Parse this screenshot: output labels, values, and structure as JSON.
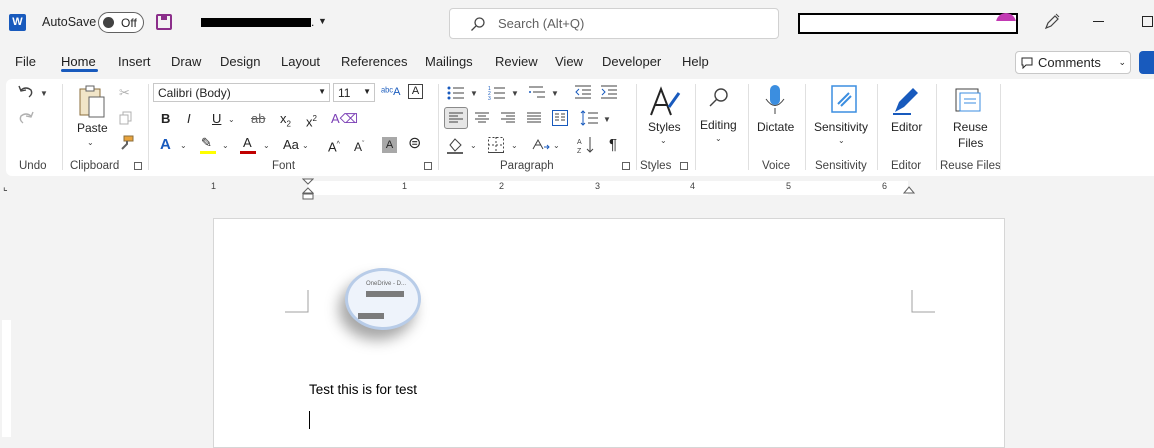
{
  "titlebar": {
    "app_icon": "word-icon",
    "autosave_label": "AutoSave",
    "autosave_state": "Off",
    "docname_suffix": ".",
    "search_placeholder": "Search (Alt+Q)"
  },
  "tabs": [
    "File",
    "Home",
    "Insert",
    "Draw",
    "Design",
    "Layout",
    "References",
    "Mailings",
    "Review",
    "View",
    "Developer",
    "Help"
  ],
  "active_tab": "Home",
  "comments_label": "Comments",
  "ribbon": {
    "groups": {
      "undo": "Undo",
      "clipboard": "Clipboard",
      "font": "Font",
      "paragraph": "Paragraph",
      "styles": "Styles",
      "voice": "Voice",
      "sensitivity": "Sensitivity",
      "editor": "Editor",
      "reuse_files": "Reuse Files"
    },
    "paste_label": "Paste",
    "font_name": "Calibri (Body)",
    "font_size": "11",
    "styles_label": "Styles",
    "editing_label": "Editing",
    "dictate_label": "Dictate",
    "sensitivity_label": "Sensitivity",
    "editor_label": "Editor",
    "reuse_label_1": "Reuse",
    "reuse_label_2": "Files",
    "bold": "B",
    "italic": "I",
    "underline": "U",
    "strike": "ab",
    "sub": "x",
    "sup": "x",
    "font_color_letter": "A",
    "highlight_color": "#ffff00",
    "font_color": "#c00000",
    "change_case": "Aa",
    "grow": "A",
    "shrink": "A",
    "pilcrow": "¶"
  },
  "ruler_numbers": [
    "1",
    "1",
    "2",
    "3",
    "4",
    "5",
    "6"
  ],
  "document": {
    "picture_caption": "OneDrive - D...",
    "body_text": "Test this is for test"
  },
  "colors": {
    "accent": "#185abd",
    "ribbon_bg": "#ffffff",
    "chrome_bg": "#f3f3f3"
  }
}
